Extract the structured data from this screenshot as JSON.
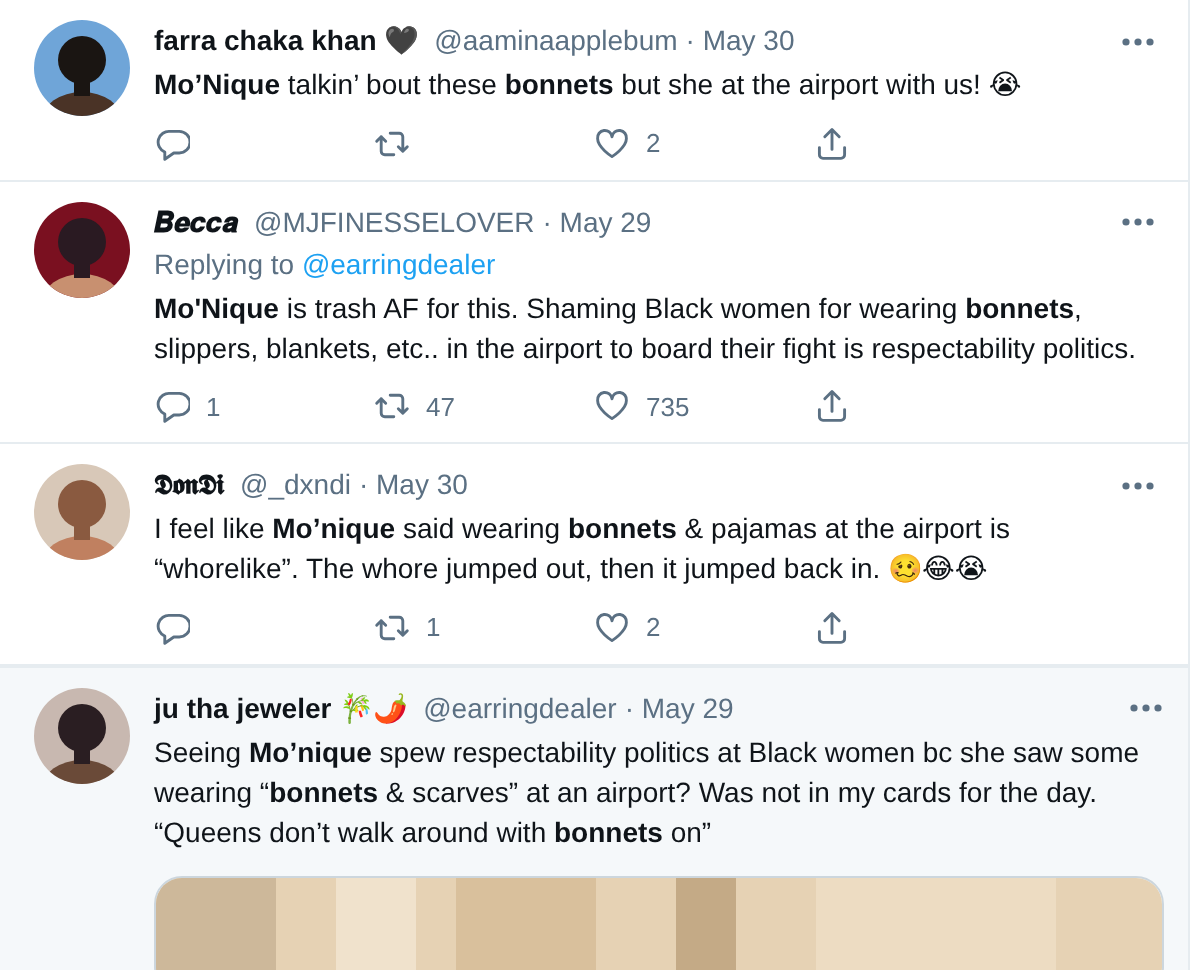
{
  "tweets": [
    {
      "name": "farra chaka khan 🖤",
      "handle": "@aaminaapplebum",
      "date": "· May 30",
      "highlighted": false,
      "text": "**Mo’Nique** talkin’ bout these **bonnets** but she at the airport with us! 😭",
      "actions": [
        {
          "kind": "reply"
        },
        {
          "kind": "retweet"
        },
        {
          "kind": "like",
          "count": "2"
        },
        {
          "kind": "share"
        }
      ]
    },
    {
      "name": "𝑩𝒆𝒄𝒄𝒂",
      "handle": "@MJFINESSELOVER",
      "date": "· May 29",
      "highlighted": false,
      "replying_label": "Replying to",
      "replying_to": "@earringdealer",
      "text": "**Mo'Nique** is trash AF for this. Shaming Black women for wearing **bonnets**, slippers, blankets, etc.. in the airport to board their fight is respectability politics.",
      "actions": [
        {
          "kind": "reply",
          "count": "1"
        },
        {
          "kind": "retweet",
          "count": "47"
        },
        {
          "kind": "like",
          "count": "735"
        },
        {
          "kind": "share"
        }
      ]
    },
    {
      "name": "𝕯𝖔𝖓𝕯𝖎",
      "handle": "@_dxndi",
      "date": "· May 30",
      "highlighted": false,
      "text": "I feel like **Mo’nique** said wearing **bonnets** & pajamas at the airport is “whorelike”. The whore jumped out, then it jumped back in. 🥴😂😭",
      "actions": [
        {
          "kind": "reply"
        },
        {
          "kind": "retweet",
          "count": "1"
        },
        {
          "kind": "like",
          "count": "2"
        },
        {
          "kind": "share"
        }
      ]
    },
    {
      "name": "ju tha jeweler 🎋🌶️",
      "handle": "@earringdealer",
      "date": "· May 29",
      "highlighted": true,
      "text": "Seeing **Mo’nique** spew respectability politics at Black women bc she saw some wearing “**bonnets** & scarves” at an airport? Was not in my cards for the day. “Queens don’t walk around with **bonnets** on”"
    }
  ]
}
